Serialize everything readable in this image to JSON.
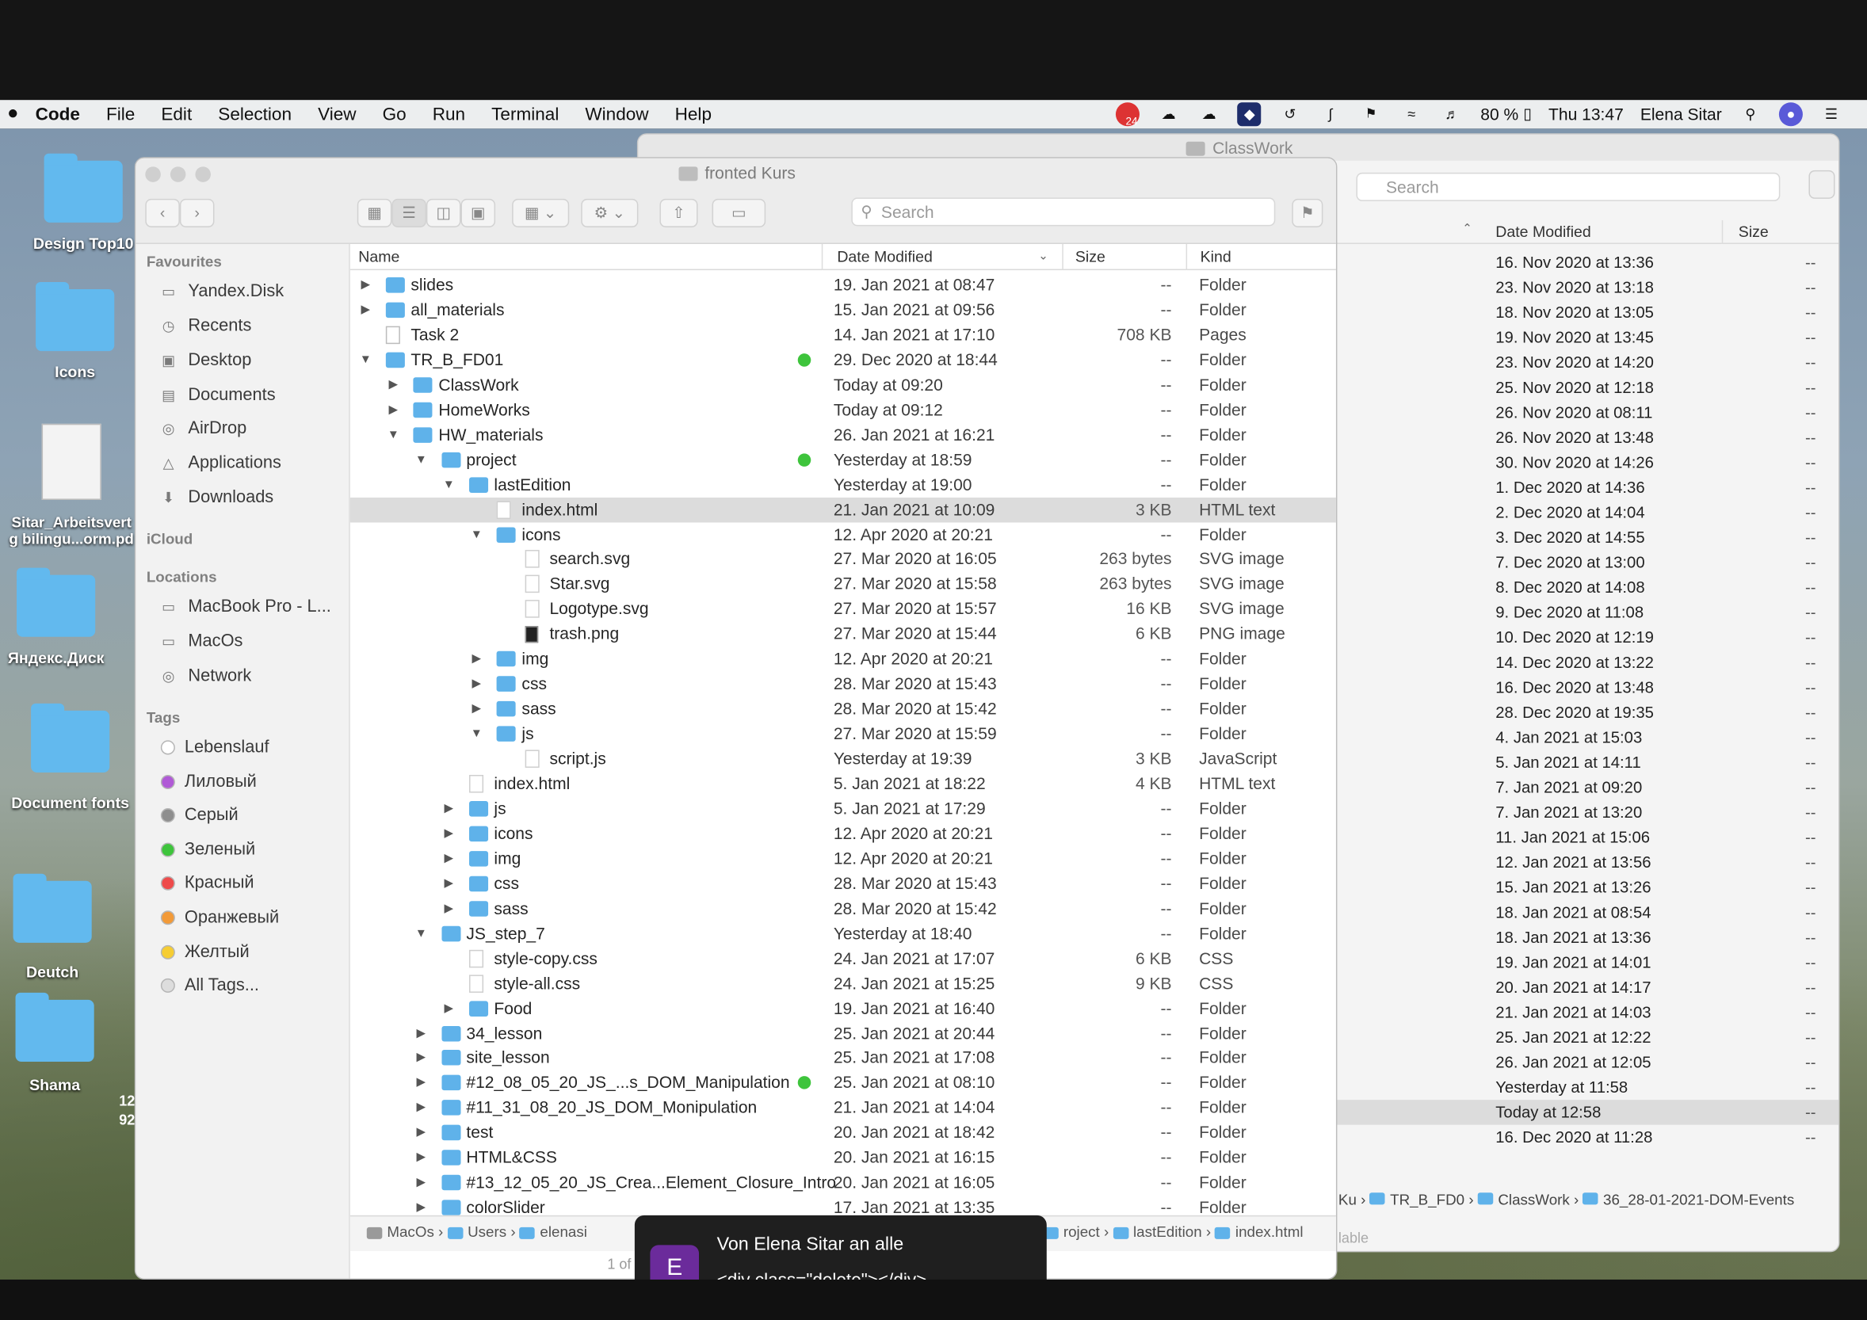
{
  "menubar": {
    "app": "Code",
    "items": [
      "File",
      "Edit",
      "Selection",
      "View",
      "Go",
      "Run",
      "Terminal",
      "Window",
      "Help"
    ],
    "status_badge": "24",
    "battery": "80 %",
    "clock": "Thu 13:47",
    "user": "Elena Sitar"
  },
  "desktop": {
    "icons": [
      "Design Top10",
      "Icons",
      "Sitar_Arbeitsvert",
      "g bilingu...orm.pd",
      "Яндекс.Диск",
      "Document fonts",
      "Deutch",
      "Shama"
    ],
    "partial_text": [
      "12",
      "92"
    ]
  },
  "back_window": {
    "title": "ClassWork",
    "search_placeholder": "Search",
    "headers": {
      "date": "Date Modified",
      "size": "Size"
    },
    "rows": [
      {
        "date": "16. Nov 2020 at 13:36",
        "size": "--"
      },
      {
        "date": "23. Nov 2020 at 13:18",
        "size": "--"
      },
      {
        "date": "18. Nov 2020 at 13:05",
        "size": "--"
      },
      {
        "date": "19. Nov 2020 at 13:45",
        "size": "--"
      },
      {
        "date": "23. Nov 2020 at 14:20",
        "size": "--"
      },
      {
        "date": "25. Nov 2020 at 12:18",
        "size": "--"
      },
      {
        "date": "26. Nov 2020 at 08:11",
        "size": "--"
      },
      {
        "date": "26. Nov 2020 at 13:48",
        "size": "--"
      },
      {
        "date": "30. Nov 2020 at 14:26",
        "size": "--"
      },
      {
        "date": "1. Dec 2020 at 14:36",
        "size": "--"
      },
      {
        "date": "2. Dec 2020 at 14:04",
        "size": "--"
      },
      {
        "date": "3. Dec 2020 at 14:55",
        "size": "--"
      },
      {
        "date": "7. Dec 2020 at 13:00",
        "size": "--"
      },
      {
        "date": "8. Dec 2020 at 14:08",
        "size": "--"
      },
      {
        "date": "9. Dec 2020 at 11:08",
        "size": "--"
      },
      {
        "date": "10. Dec 2020 at 12:19",
        "size": "--"
      },
      {
        "date": "14. Dec 2020 at 13:22",
        "size": "--"
      },
      {
        "date": "16. Dec 2020 at 13:48",
        "size": "--"
      },
      {
        "date": "28. Dec 2020 at 19:35",
        "size": "--"
      },
      {
        "date": "4. Jan 2021 at 15:03",
        "size": "--"
      },
      {
        "date": "5. Jan 2021 at 14:11",
        "size": "--"
      },
      {
        "date": "7. Jan 2021 at 09:20",
        "size": "--"
      },
      {
        "date": "7. Jan 2021 at 13:20",
        "size": "--"
      },
      {
        "date": "11. Jan 2021 at 15:06",
        "size": "--"
      },
      {
        "date": "12. Jan 2021 at 13:56",
        "size": "--"
      },
      {
        "date": "15. Jan 2021 at 13:26",
        "size": "--"
      },
      {
        "date": "18. Jan 2021 at 08:54",
        "size": "--"
      },
      {
        "date": "18. Jan 2021 at 13:36",
        "size": "--"
      },
      {
        "date": "19. Jan 2021 at 14:01",
        "size": "--"
      },
      {
        "date": "20. Jan 2021 at 14:17",
        "size": "--"
      },
      {
        "date": "21. Jan 2021 at 14:03",
        "size": "--"
      },
      {
        "date": "25. Jan 2021 at 12:22",
        "size": "--"
      },
      {
        "date": "26. Jan 2021 at 12:05",
        "size": "--"
      },
      {
        "date": "Yesterday at 11:58",
        "size": "--"
      },
      {
        "date": "Today at 12:58",
        "size": "--"
      },
      {
        "date": "16. Dec 2020 at 11:28",
        "size": "--"
      }
    ],
    "path": [
      "Ku",
      "TR_B_FD0",
      "ClassWork",
      "36_28-01-2021-DOM-Events"
    ],
    "status": "lable"
  },
  "front_window": {
    "title": "fronted Kurs",
    "search_placeholder": "Search",
    "sidebar": {
      "favourites_label": "Favourites",
      "favourites": [
        "Yandex.Disk",
        "Recents",
        "Desktop",
        "Documents",
        "AirDrop",
        "Applications",
        "Downloads"
      ],
      "icloud_label": "iCloud",
      "locations_label": "Locations",
      "locations": [
        "MacBook Pro - L...",
        "MacOs",
        "Network"
      ],
      "tags_label": "Tags",
      "tags": [
        {
          "name": "Lebenslauf",
          "color": "#ffffff"
        },
        {
          "name": "Лиловый",
          "color": "#b05ad6"
        },
        {
          "name": "Серый",
          "color": "#8e8e8e"
        },
        {
          "name": "Зеленый",
          "color": "#3ec43c"
        },
        {
          "name": "Красный",
          "color": "#ee4b4b"
        },
        {
          "name": "Оранжевый",
          "color": "#f29a38"
        },
        {
          "name": "Желтый",
          "color": "#f6cd33"
        },
        {
          "name": "All Tags...",
          "color": "#dddddd"
        }
      ]
    },
    "headers": {
      "name": "Name",
      "date": "Date Modified",
      "size": "Size",
      "kind": "Kind"
    },
    "rows": [
      {
        "name": "slides",
        "date": "19. Jan 2021 at 08:47",
        "size": "--",
        "kind": "Folder",
        "depth": 0,
        "toggle": "closed",
        "icon": "folder"
      },
      {
        "name": "all_materials",
        "date": "15. Jan 2021 at 09:56",
        "size": "--",
        "kind": "Folder",
        "depth": 0,
        "toggle": "closed",
        "icon": "folder"
      },
      {
        "name": "Task 2",
        "date": "14. Jan 2021 at 17:10",
        "size": "708 KB",
        "kind": "Pages",
        "depth": 0,
        "toggle": "none",
        "icon": "pages"
      },
      {
        "name": "TR_B_FD01",
        "date": "29. Dec 2020 at 18:44",
        "size": "--",
        "kind": "Folder",
        "depth": 0,
        "toggle": "open",
        "icon": "folder",
        "tag": "#3ec43c"
      },
      {
        "name": "ClassWork",
        "date": "Today at 09:20",
        "size": "--",
        "kind": "Folder",
        "depth": 1,
        "toggle": "closed",
        "icon": "folder"
      },
      {
        "name": "HomeWorks",
        "date": "Today at 09:12",
        "size": "--",
        "kind": "Folder",
        "depth": 1,
        "toggle": "closed",
        "icon": "folder"
      },
      {
        "name": "HW_materials",
        "date": "26. Jan 2021 at 16:21",
        "size": "--",
        "kind": "Folder",
        "depth": 1,
        "toggle": "open",
        "icon": "folder"
      },
      {
        "name": "project",
        "date": "Yesterday at 18:59",
        "size": "--",
        "kind": "Folder",
        "depth": 2,
        "toggle": "open",
        "icon": "folder",
        "tag": "#3ec43c"
      },
      {
        "name": "lastEdition",
        "date": "Yesterday at 19:00",
        "size": "--",
        "kind": "Folder",
        "depth": 3,
        "toggle": "open",
        "icon": "folder"
      },
      {
        "name": "index.html",
        "date": "21. Jan 2021 at 10:09",
        "size": "3 KB",
        "kind": "HTML text",
        "depth": 4,
        "toggle": "none",
        "icon": "doc",
        "selected": true
      },
      {
        "name": "icons",
        "date": "12. Apr 2020 at 20:21",
        "size": "--",
        "kind": "Folder",
        "depth": 4,
        "toggle": "open",
        "icon": "folder"
      },
      {
        "name": "search.svg",
        "date": "27. Mar 2020 at 16:05",
        "size": "263 bytes",
        "kind": "SVG image",
        "depth": 5,
        "toggle": "none",
        "icon": "doc"
      },
      {
        "name": "Star.svg",
        "date": "27. Mar 2020 at 15:58",
        "size": "263 bytes",
        "kind": "SVG image",
        "depth": 5,
        "toggle": "none",
        "icon": "doc"
      },
      {
        "name": "Logotype.svg",
        "date": "27. Mar 2020 at 15:57",
        "size": "16 KB",
        "kind": "SVG image",
        "depth": 5,
        "toggle": "none",
        "icon": "doc"
      },
      {
        "name": "trash.png",
        "date": "27. Mar 2020 at 15:44",
        "size": "6 KB",
        "kind": "PNG image",
        "depth": 5,
        "toggle": "none",
        "icon": "png"
      },
      {
        "name": "img",
        "date": "12. Apr 2020 at 20:21",
        "size": "--",
        "kind": "Folder",
        "depth": 4,
        "toggle": "closed",
        "icon": "folder"
      },
      {
        "name": "css",
        "date": "28. Mar 2020 at 15:43",
        "size": "--",
        "kind": "Folder",
        "depth": 4,
        "toggle": "closed",
        "icon": "folder"
      },
      {
        "name": "sass",
        "date": "28. Mar 2020 at 15:42",
        "size": "--",
        "kind": "Folder",
        "depth": 4,
        "toggle": "closed",
        "icon": "folder"
      },
      {
        "name": "js",
        "date": "27. Mar 2020 at 15:59",
        "size": "--",
        "kind": "Folder",
        "depth": 4,
        "toggle": "open",
        "icon": "folder"
      },
      {
        "name": "script.js",
        "date": "Yesterday at 19:39",
        "size": "3 KB",
        "kind": "JavaScript",
        "depth": 5,
        "toggle": "none",
        "icon": "doc"
      },
      {
        "name": "index.html",
        "date": "5. Jan 2021 at 18:22",
        "size": "4 KB",
        "kind": "HTML text",
        "depth": 3,
        "toggle": "none",
        "icon": "doc"
      },
      {
        "name": "js",
        "date": "5. Jan 2021 at 17:29",
        "size": "--",
        "kind": "Folder",
        "depth": 3,
        "toggle": "closed",
        "icon": "folder"
      },
      {
        "name": "icons",
        "date": "12. Apr 2020 at 20:21",
        "size": "--",
        "kind": "Folder",
        "depth": 3,
        "toggle": "closed",
        "icon": "folder"
      },
      {
        "name": "img",
        "date": "12. Apr 2020 at 20:21",
        "size": "--",
        "kind": "Folder",
        "depth": 3,
        "toggle": "closed",
        "icon": "folder"
      },
      {
        "name": "css",
        "date": "28. Mar 2020 at 15:43",
        "size": "--",
        "kind": "Folder",
        "depth": 3,
        "toggle": "closed",
        "icon": "folder"
      },
      {
        "name": "sass",
        "date": "28. Mar 2020 at 15:42",
        "size": "--",
        "kind": "Folder",
        "depth": 3,
        "toggle": "closed",
        "icon": "folder"
      },
      {
        "name": "JS_step_7",
        "date": "Yesterday at 18:40",
        "size": "--",
        "kind": "Folder",
        "depth": 2,
        "toggle": "open",
        "icon": "folder"
      },
      {
        "name": "style-copy.css",
        "date": "24. Jan 2021 at 17:07",
        "size": "6 KB",
        "kind": "CSS",
        "depth": 3,
        "toggle": "none",
        "icon": "doc"
      },
      {
        "name": "style-all.css",
        "date": "24. Jan 2021 at 15:25",
        "size": "9 KB",
        "kind": "CSS",
        "depth": 3,
        "toggle": "none",
        "icon": "doc"
      },
      {
        "name": "Food",
        "date": "19. Jan 2021 at 16:40",
        "size": "--",
        "kind": "Folder",
        "depth": 3,
        "toggle": "closed",
        "icon": "folder"
      },
      {
        "name": "34_lesson",
        "date": "25. Jan 2021 at 20:44",
        "size": "--",
        "kind": "Folder",
        "depth": 2,
        "toggle": "closed",
        "icon": "folder"
      },
      {
        "name": "site_lesson",
        "date": "25. Jan 2021 at 17:08",
        "size": "--",
        "kind": "Folder",
        "depth": 2,
        "toggle": "closed",
        "icon": "folder"
      },
      {
        "name": "#12_08_05_20_JS_...s_DOM_Manipulation",
        "date": "25. Jan 2021 at 08:10",
        "size": "--",
        "kind": "Folder",
        "depth": 2,
        "toggle": "closed",
        "icon": "folder",
        "tag": "#3ec43c"
      },
      {
        "name": "#11_31_08_20_JS_DOM_Monipulation",
        "date": "21. Jan 2021 at 14:04",
        "size": "--",
        "kind": "Folder",
        "depth": 2,
        "toggle": "closed",
        "icon": "folder"
      },
      {
        "name": "test",
        "date": "20. Jan 2021 at 18:42",
        "size": "--",
        "kind": "Folder",
        "depth": 2,
        "toggle": "closed",
        "icon": "folder"
      },
      {
        "name": "HTML&CSS",
        "date": "20. Jan 2021 at 16:15",
        "size": "--",
        "kind": "Folder",
        "depth": 2,
        "toggle": "closed",
        "icon": "folder"
      },
      {
        "name": "#13_12_05_20_JS_Crea...Element_Closure_Intro",
        "date": "20. Jan 2021 at 16:05",
        "size": "--",
        "kind": "Folder",
        "depth": 2,
        "toggle": "closed",
        "icon": "folder"
      },
      {
        "name": "colorSlider",
        "date": "17. Jan 2021 at 13:35",
        "size": "--",
        "kind": "Folder",
        "depth": 2,
        "toggle": "closed",
        "icon": "folder"
      }
    ],
    "path_left": [
      "MacOs",
      "Users",
      "elenasi"
    ],
    "path_right": [
      "roject",
      "lastEdition",
      "index.html"
    ],
    "status": "1 of"
  },
  "chat": {
    "avatar_letter": "E",
    "from": "Von Elena Sitar an alle",
    "message": "<div class=\"delete\"></div>",
    "avatar_color": "#6b2b9b"
  }
}
